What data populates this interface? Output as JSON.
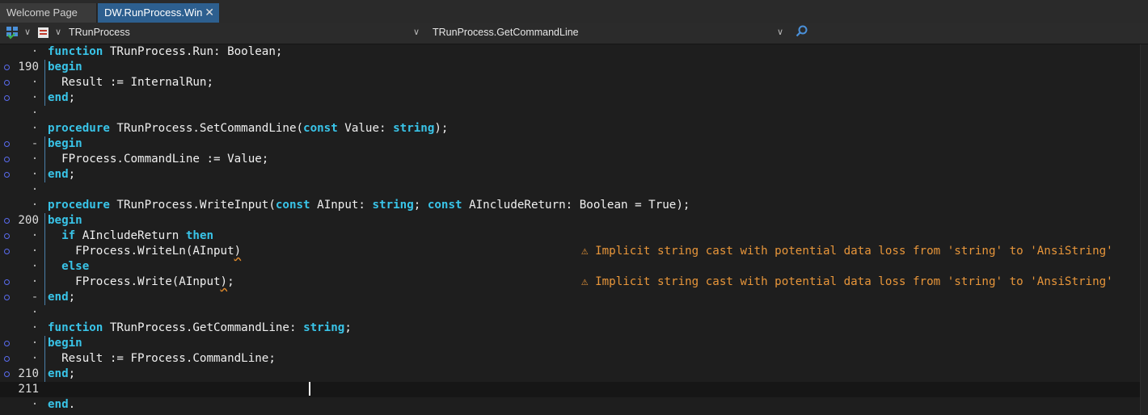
{
  "tabs": [
    {
      "label": "Welcome Page",
      "active": false
    },
    {
      "label": "DW.RunProcess.Win",
      "active": true,
      "close_glyph": "✕"
    }
  ],
  "toolbar": {
    "class_selector": "TRunProcess",
    "method_selector": "TRunProcess.GetCommandLine",
    "icons": [
      "structure-icon",
      "unit-icon",
      "search-icon"
    ]
  },
  "colors": {
    "keyword": "#39c4e8",
    "warning": "#e8963a",
    "active_tab": "#2d5f8f",
    "gutter_mark": "#5a6cf0"
  },
  "editor": {
    "current_line": 211,
    "lines": [
      {
        "num": "",
        "mark": false,
        "dot": "·",
        "parts": [
          [
            "kw",
            "function"
          ],
          [
            "",
            "TRunProcess.Run: Boolean;"
          ]
        ]
      },
      {
        "num": "190",
        "mark": true,
        "dot": "",
        "parts": [
          [
            "kw",
            "begin"
          ]
        ]
      },
      {
        "num": "",
        "mark": true,
        "dot": "·",
        "parts": [
          [
            "",
            "  Result := InternalRun;"
          ]
        ]
      },
      {
        "num": "",
        "mark": true,
        "dot": "·",
        "parts": [
          [
            "kw",
            "end"
          ],
          [
            "",
            ";"
          ]
        ]
      },
      {
        "num": "",
        "mark": false,
        "dot": "·",
        "parts": []
      },
      {
        "num": "",
        "mark": false,
        "dot": "·",
        "parts": [
          [
            "kw",
            "procedure"
          ],
          [
            "",
            "TRunProcess.SetCommandLine("
          ],
          [
            "kw",
            "const"
          ],
          [
            "",
            " Value: "
          ],
          [
            "kw",
            "string"
          ],
          [
            "",
            ");"
          ]
        ]
      },
      {
        "num": "",
        "mark": true,
        "dot": "-",
        "parts": [
          [
            "kw",
            "begin"
          ]
        ]
      },
      {
        "num": "",
        "mark": true,
        "dot": "·",
        "parts": [
          [
            "",
            "  FProcess.CommandLine := Value;"
          ]
        ]
      },
      {
        "num": "",
        "mark": true,
        "dot": "·",
        "parts": [
          [
            "kw",
            "end"
          ],
          [
            "",
            ";"
          ]
        ]
      },
      {
        "num": "",
        "mark": false,
        "dot": "·",
        "parts": []
      },
      {
        "num": "",
        "mark": false,
        "dot": "·",
        "parts": [
          [
            "kw",
            "procedure"
          ],
          [
            "",
            "TRunProcess.WriteInput("
          ],
          [
            "kw",
            "const"
          ],
          [
            "",
            " AInput: "
          ],
          [
            "kw",
            "string"
          ],
          [
            "",
            "; "
          ],
          [
            "kw",
            "const"
          ],
          [
            "",
            " AIncludeReturn: Boolean = True);"
          ]
        ]
      },
      {
        "num": "200",
        "mark": true,
        "dot": "",
        "parts": [
          [
            "kw",
            "begin"
          ]
        ]
      },
      {
        "num": "",
        "mark": true,
        "dot": "·",
        "parts": [
          [
            "",
            "  "
          ],
          [
            "kw",
            "if"
          ],
          [
            "",
            " AIncludeReturn "
          ],
          [
            "kw",
            "then"
          ]
        ]
      },
      {
        "num": "",
        "mark": true,
        "dot": "·",
        "parts": [
          [
            "",
            "    FProcess.WriteLn(AInput"
          ],
          [
            "sq",
            ")"
          ]
        ],
        "warning": "⚠ Implicit string cast with potential data loss from 'string' to 'AnsiString'"
      },
      {
        "num": "",
        "mark": false,
        "dot": "·",
        "parts": [
          [
            "",
            "  "
          ],
          [
            "kw",
            "else"
          ]
        ]
      },
      {
        "num": "",
        "mark": true,
        "dot": "·",
        "parts": [
          [
            "",
            "    FProcess.Write(AInput"
          ],
          [
            "sq",
            ")"
          ],
          [
            "",
            ";"
          ]
        ],
        "warning": "⚠ Implicit string cast with potential data loss from 'string' to 'AnsiString'"
      },
      {
        "num": "",
        "mark": true,
        "dot": "-",
        "parts": [
          [
            "kw",
            "end"
          ],
          [
            "",
            ";"
          ]
        ]
      },
      {
        "num": "",
        "mark": false,
        "dot": "·",
        "parts": []
      },
      {
        "num": "",
        "mark": false,
        "dot": "·",
        "parts": [
          [
            "kw",
            "function"
          ],
          [
            "",
            "TRunProcess.GetCommandLine: "
          ],
          [
            "kw",
            "string"
          ],
          [
            "",
            ";"
          ]
        ]
      },
      {
        "num": "",
        "mark": true,
        "dot": "·",
        "parts": [
          [
            "kw",
            "begin"
          ]
        ]
      },
      {
        "num": "",
        "mark": true,
        "dot": "·",
        "parts": [
          [
            "",
            "  Result := FProcess.CommandLine;"
          ]
        ]
      },
      {
        "num": "210",
        "mark": true,
        "dot": "",
        "parts": [
          [
            "kw",
            "end"
          ],
          [
            "",
            ";"
          ]
        ]
      },
      {
        "num": "211",
        "mark": false,
        "dot": "",
        "parts": []
      },
      {
        "num": "",
        "mark": false,
        "dot": "·",
        "parts": [
          [
            "kw",
            "end"
          ],
          [
            "",
            "."
          ]
        ]
      }
    ]
  }
}
